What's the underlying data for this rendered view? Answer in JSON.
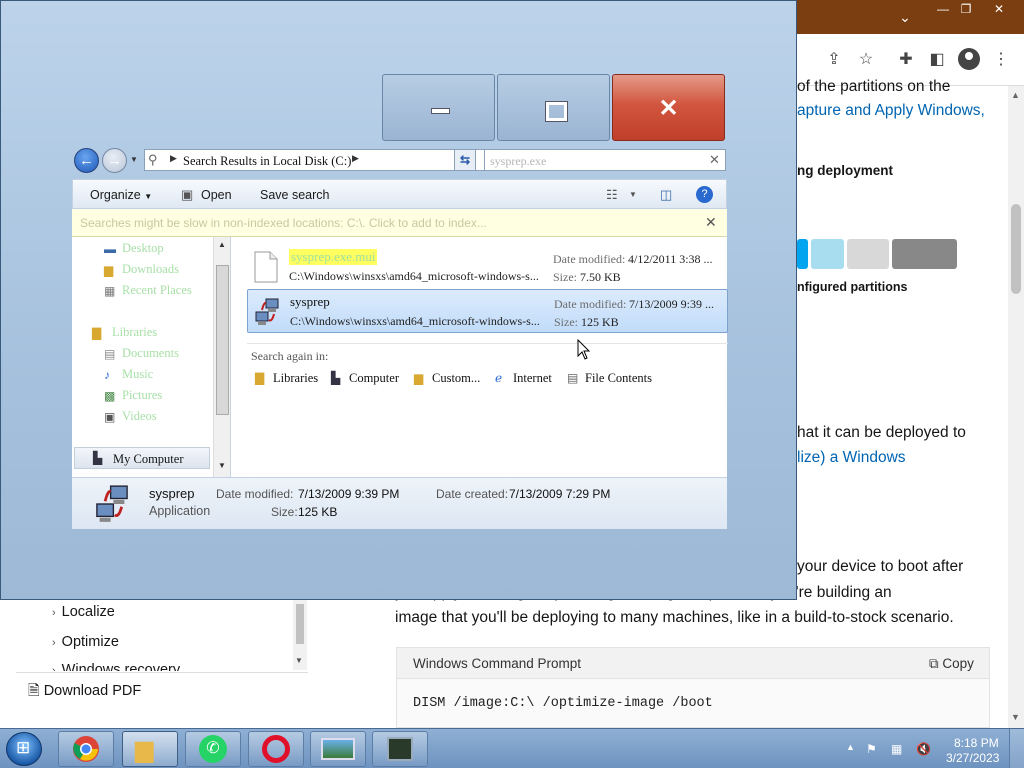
{
  "browser": {
    "titlebar": {
      "chevron": "⌄",
      "minimize": "—",
      "restore": "❐",
      "close": "✕"
    },
    "toolbar_icons": [
      "share-icon",
      "star-icon",
      "extensions-icon",
      "sidebar-icon",
      "profile-icon",
      "menu-icon"
    ],
    "page": {
      "lines": [
        "of the partitions on the",
        "apture and Apply Windows,",
        "ng deployment",
        "nfigured partitions",
        "hat it can be deployed to",
        "lize) a Windows",
        "your device to boot after",
        "you apply the image. Optimizing an image helps when you're building an",
        "image that you'll be deploying to many machines, like in a build-to-stock scenario."
      ],
      "tile_colors": [
        "#00a4ef",
        "#a8ddef",
        "#d8d8d8",
        "#888888"
      ]
    },
    "toc": {
      "items": [
        "Localize",
        "Optimize",
        "Windows recovery"
      ],
      "download_pdf": "Download PDF"
    },
    "code_block": {
      "title": "Windows Command Prompt",
      "copy_label": "Copy",
      "code": "DISM /image:C:\\ /optimize-image /boot"
    }
  },
  "explorer": {
    "address": {
      "path": "Search Results in Local Disk (C:)",
      "search_value": "sysprep.exe"
    },
    "commands": {
      "organize": "Organize",
      "open": "Open",
      "save_search": "Save search"
    },
    "infobar": "Searches might be slow in non-indexed locations: C:\\. Click to add to index...",
    "nav": {
      "favorites": [
        "Desktop",
        "Downloads",
        "Recent Places"
      ],
      "libraries_header": "Libraries",
      "libraries": [
        "Documents",
        "Music",
        "Pictures",
        "Videos"
      ],
      "my_computer": "My Computer"
    },
    "results": [
      {
        "name": "sysprep.exe.mui",
        "path": "C:\\Windows\\winsxs\\amd64_microsoft-windows-s...",
        "date_label": "Date modified:",
        "date": "4/12/2011 3:38 ...",
        "size_label": "Size:",
        "size": "7.50 KB"
      },
      {
        "name": "sysprep",
        "path": "C:\\Windows\\winsxs\\amd64_microsoft-windows-s...",
        "date_label": "Date modified:",
        "date": "7/13/2009 9:39 ...",
        "size_label": "Size:",
        "size": "125 KB"
      }
    ],
    "search_again": {
      "label": "Search again in:",
      "options": [
        "Libraries",
        "Computer",
        "Custom...",
        "Internet",
        "File Contents"
      ]
    },
    "details": {
      "name": "sysprep",
      "type": "Application",
      "date_modified_label": "Date modified:",
      "date_modified": "7/13/2009 9:39 PM",
      "date_created_label": "Date created:",
      "date_created": "7/13/2009 7:29 PM",
      "size_label": "Size:",
      "size": "125 KB"
    }
  },
  "taskbar": {
    "apps": [
      "explorer",
      "chrome",
      "whatsapp",
      "opera",
      "image-viewer",
      "terminal"
    ],
    "clock": {
      "time": "8:18 PM",
      "date": "3/27/2023"
    }
  }
}
